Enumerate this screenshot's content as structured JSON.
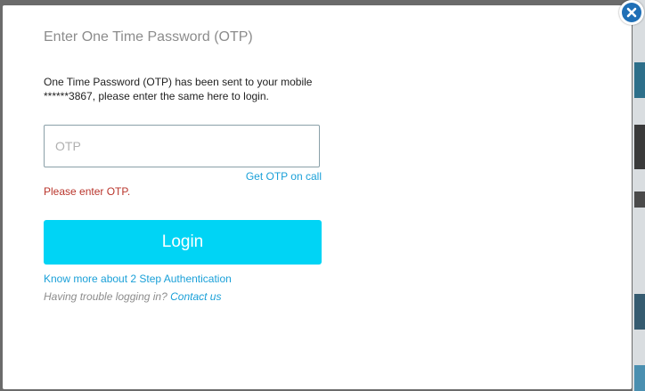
{
  "dialog": {
    "title": "Enter One Time Password (OTP)",
    "message_line1": "One Time Password (OTP) has been sent to your mobile",
    "message_line2": "******3867, please enter the same here to login.",
    "otp_input": {
      "placeholder": "OTP",
      "value": ""
    },
    "get_otp_call_label": "Get OTP on call",
    "error_text": "Please enter OTP.",
    "login_label": "Login",
    "two_step_link": "Know more about 2 Step Authentication",
    "trouble_text": "Having trouble logging in?",
    "contact_label": "Contact us",
    "close_icon": "close-icon"
  },
  "colors": {
    "accent": "#00d4f5",
    "link": "#1aa0d8",
    "error": "#b9352c",
    "close_button": "#1f6fb6"
  }
}
